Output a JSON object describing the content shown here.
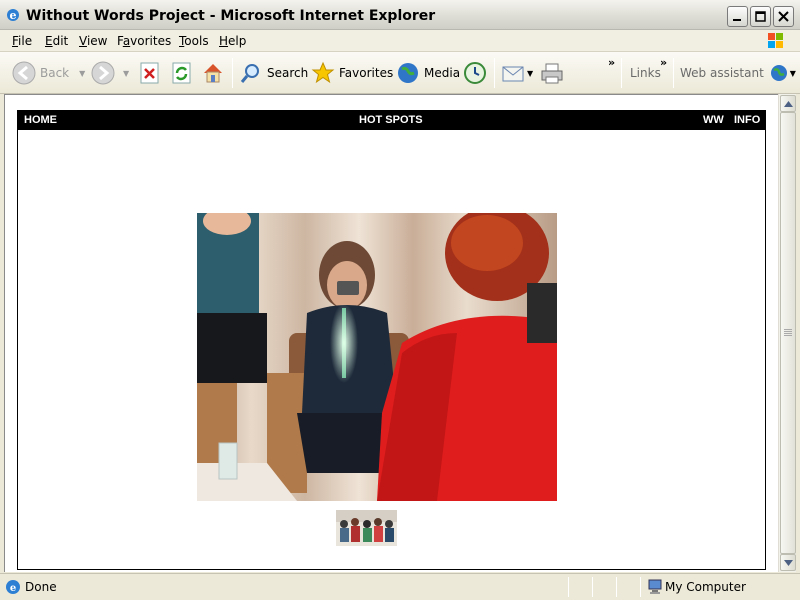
{
  "window": {
    "title": "Without Words Project - Microsoft Internet Explorer"
  },
  "menu": {
    "items": [
      {
        "label": "File",
        "key": "F",
        "rest": "ile"
      },
      {
        "label": "Edit",
        "key": "E",
        "rest": "dit"
      },
      {
        "label": "View",
        "key": "V",
        "rest": "iew"
      },
      {
        "label": "Favorites",
        "key": "a",
        "pre": "F",
        "rest": "vorites"
      },
      {
        "label": "Tools",
        "key": "T",
        "rest": "ools"
      },
      {
        "label": "Help",
        "key": "H",
        "rest": "elp"
      }
    ]
  },
  "toolbar": {
    "back_label": "Back",
    "search_label": "Search",
    "favorites_label": "Favorites",
    "media_label": "Media",
    "links_label": "Links",
    "web_assistant_label": "Web assistant"
  },
  "site": {
    "nav": {
      "home": "HOME",
      "hot_spots": "HOT SPOTS",
      "ww": "WW",
      "info": "INFO"
    }
  },
  "status": {
    "text": "Done",
    "zone": "My Computer"
  },
  "colors": {
    "nav_background": "#000000",
    "nav_text": "#ffffff",
    "chrome": "#ece9d8"
  }
}
